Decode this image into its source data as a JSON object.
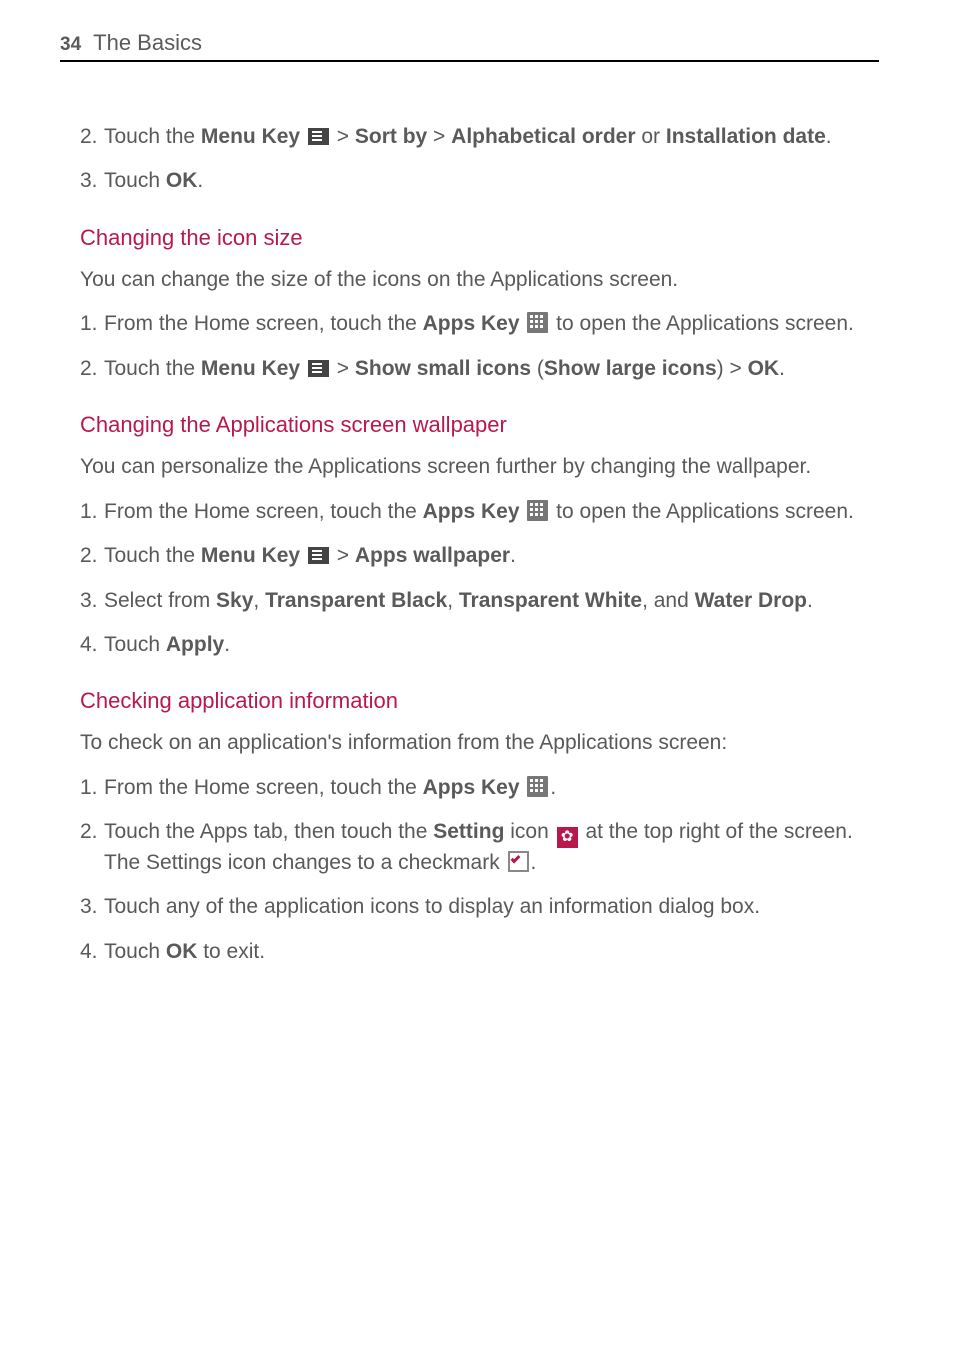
{
  "header": {
    "page_number": "34",
    "chapter": "The Basics"
  },
  "step2a_pre": "Touch the ",
  "step2a_bold1": "Menu Key",
  "step2a_mid1": " > ",
  "step2a_bold2": "Sort by",
  "step2a_mid2": " > ",
  "step2a_bold3": "Alphabetical order",
  "step2a_mid3": " or ",
  "step2a_bold4": "Installation date",
  "step2a_end": ".",
  "step3a_pre": "Touch ",
  "step3a_bold": "OK",
  "step3a_end": ".",
  "h1": "Changing the icon size",
  "p1": "You can change the size of the icons on the Applications screen.",
  "s1_1_pre": "From the Home screen, touch the ",
  "s1_1_bold": "Apps Key",
  "s1_1_post": " to open the Applications screen.",
  "s1_2_pre": "Touch the ",
  "s1_2_bold1": "Menu Key",
  "s1_2_mid1": " > ",
  "s1_2_bold2": "Show small icons",
  "s1_2_mid2": " (",
  "s1_2_bold3": "Show large icons",
  "s1_2_mid3": ") > ",
  "s1_2_bold4": "OK",
  "s1_2_end": ".",
  "h2": "Changing the Applications screen wallpaper",
  "p2": "You can personalize the Applications screen further by changing the wallpaper.",
  "s2_1_pre": "From the Home screen, touch the ",
  "s2_1_bold": "Apps Key",
  "s2_1_post": " to open the Applications screen.",
  "s2_2_pre": "Touch the ",
  "s2_2_bold1": "Menu Key",
  "s2_2_mid": " > ",
  "s2_2_bold2": "Apps wallpaper",
  "s2_2_end": ".",
  "s2_3_pre": "Select from ",
  "s2_3_b1": "Sky",
  "s2_3_c1": ", ",
  "s2_3_b2": "Transparent Black",
  "s2_3_c2": ", ",
  "s2_3_b3": "Transparent White",
  "s2_3_c3": ", and ",
  "s2_3_b4": "Water Drop",
  "s2_3_end": ".",
  "s2_4_pre": "Touch ",
  "s2_4_bold": "Apply",
  "s2_4_end": ".",
  "h3": "Checking application information",
  "p3": "To check on an application's information from the Applications screen:",
  "s3_1_pre": "From the Home screen, touch the ",
  "s3_1_bold": "Apps Key",
  "s3_1_end": ".",
  "s3_2_pre": "Touch the Apps tab, then touch the ",
  "s3_2_bold": "Setting",
  "s3_2_mid": " icon ",
  "s3_2_post": " at the top right of the screen. The Settings icon changes to a checkmark ",
  "s3_2_end": ".",
  "s3_3": "Touch any of the application icons to display an information dialog box.",
  "s3_4_pre": "Touch ",
  "s3_4_bold": "OK",
  "s3_4_end": " to exit.",
  "nums": {
    "n1": "1.",
    "n2": "2.",
    "n3": "3.",
    "n4": "4."
  }
}
